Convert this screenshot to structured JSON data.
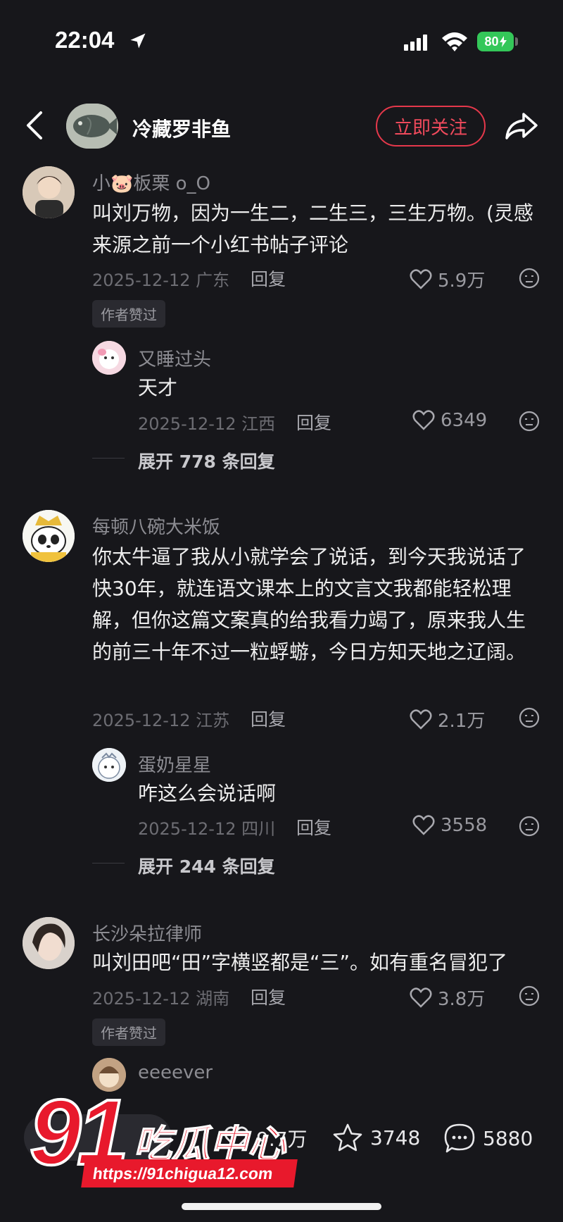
{
  "status_bar": {
    "time": "22:04",
    "battery": "80"
  },
  "header": {
    "author_name": "冷藏罗非鱼",
    "follow_label": "立即关注"
  },
  "comments": [
    {
      "user": "小🐷板栗 o_O",
      "text": "叫刘万物，因为一生二，二生三，三生万物。(灵感来源之前一个小红书帖子评论",
      "date": "2025-12-12",
      "location": "广东",
      "reply_label": "回复",
      "likes": "5.9万",
      "badge": "作者赞过",
      "reply": {
        "user": "又睡过头",
        "text": "天才",
        "date": "2025-12-12",
        "location": "江西",
        "reply_label": "回复",
        "likes": "6349"
      },
      "expand": "展开 778 条回复"
    },
    {
      "user": "每顿八碗大米饭",
      "text": "你太牛逼了我从小就学会了说话，到今天我说话了快30年，就连语文课本上的文言文我都能轻松理解，但你这篇文案真的给我看力竭了，原来我人生的前三十年不过一粒蜉蝣，今日方知天地之辽阔。",
      "date": "2025-12-12",
      "location": "江苏",
      "reply_label": "回复",
      "likes": "2.1万",
      "reply": {
        "user": "蛋奶星星",
        "text": "咋这么会说话啊",
        "date": "2025-12-12",
        "location": "四川",
        "reply_label": "回复",
        "likes": "3558"
      },
      "expand": "展开 244 条回复"
    },
    {
      "user": "长沙朵拉律师",
      "text": "叫刘田吧“田”字横竖都是“三”。如有重名冒犯了",
      "date": "2025-12-12",
      "location": "湖南",
      "reply_label": "回复",
      "likes": "3.8万",
      "badge": "作者赞过",
      "reply": {
        "user": "eeeever"
      }
    }
  ],
  "bottom_bar": {
    "input_placeholder": "点",
    "likes": "9.7万",
    "stars": "3748",
    "comments": "5880"
  },
  "watermark": {
    "number": "91",
    "brand": "吃瓜中心",
    "url": "https://91chigua12.com"
  },
  "colors": {
    "background": "#17171b",
    "accent": "#e5384b",
    "watermark_red": "#e8192c"
  }
}
